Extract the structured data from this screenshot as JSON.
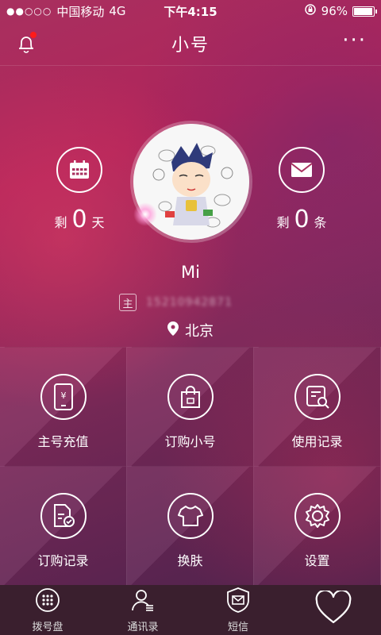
{
  "status_bar": {
    "carrier": "中国移动",
    "network": "4G",
    "time": "下午4:15",
    "battery": "96%",
    "battery_level": 0.96
  },
  "header": {
    "title": "小号",
    "more_label": "···"
  },
  "profile": {
    "days_prefix": "剩",
    "days_value": "0",
    "days_unit": "天",
    "sms_prefix": "剩",
    "sms_value": "0",
    "sms_unit": "条",
    "name": "Mi",
    "main_badge": "主",
    "phone": "15210942871",
    "location": "北京"
  },
  "grid": [
    {
      "label": "主号充值",
      "icon": "recharge-icon"
    },
    {
      "label": "订购小号",
      "icon": "shopping-bag-icon"
    },
    {
      "label": "使用记录",
      "icon": "usage-record-icon"
    },
    {
      "label": "订购记录",
      "icon": "order-record-icon"
    },
    {
      "label": "换肤",
      "icon": "tshirt-icon"
    },
    {
      "label": "设置",
      "icon": "gear-icon"
    }
  ],
  "tabs": [
    {
      "label": "拨号盘",
      "icon": "dialpad-icon"
    },
    {
      "label": "通讯录",
      "icon": "contacts-icon"
    },
    {
      "label": "短信",
      "icon": "message-icon"
    },
    {
      "label": "",
      "icon": "heart-icon"
    }
  ]
}
